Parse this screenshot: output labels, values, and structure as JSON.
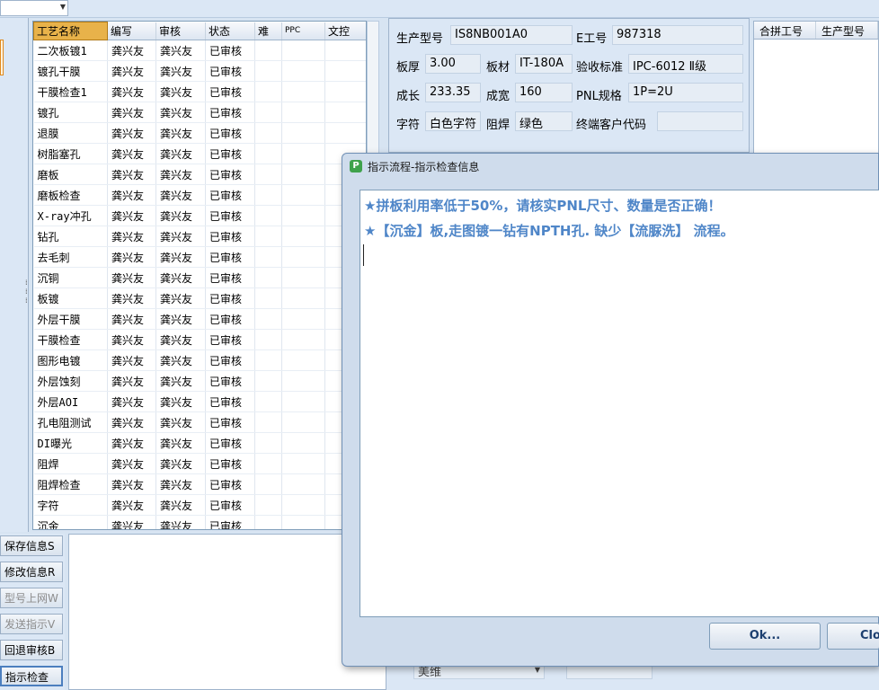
{
  "grid": {
    "headers": [
      "工艺名称",
      "编写",
      "审核",
      "状态",
      "难",
      "PPC",
      "文控"
    ],
    "rows": [
      [
        "二次板镀1",
        "龚兴友",
        "龚兴友",
        "已审核"
      ],
      [
        "镀孔干膜",
        "龚兴友",
        "龚兴友",
        "已审核"
      ],
      [
        "干膜检查1",
        "龚兴友",
        "龚兴友",
        "已审核"
      ],
      [
        "镀孔",
        "龚兴友",
        "龚兴友",
        "已审核"
      ],
      [
        "退膜",
        "龚兴友",
        "龚兴友",
        "已审核"
      ],
      [
        "树脂塞孔",
        "龚兴友",
        "龚兴友",
        "已审核"
      ],
      [
        "磨板",
        "龚兴友",
        "龚兴友",
        "已审核"
      ],
      [
        "磨板检查",
        "龚兴友",
        "龚兴友",
        "已审核"
      ],
      [
        "X-ray冲孔",
        "龚兴友",
        "龚兴友",
        "已审核"
      ],
      [
        "钻孔",
        "龚兴友",
        "龚兴友",
        "已审核"
      ],
      [
        "去毛刺",
        "龚兴友",
        "龚兴友",
        "已审核"
      ],
      [
        "沉铜",
        "龚兴友",
        "龚兴友",
        "已审核"
      ],
      [
        "板镀",
        "龚兴友",
        "龚兴友",
        "已审核"
      ],
      [
        "外层干膜",
        "龚兴友",
        "龚兴友",
        "已审核"
      ],
      [
        "干膜检查",
        "龚兴友",
        "龚兴友",
        "已审核"
      ],
      [
        "图形电镀",
        "龚兴友",
        "龚兴友",
        "已审核"
      ],
      [
        "外层蚀刻",
        "龚兴友",
        "龚兴友",
        "已审核"
      ],
      [
        "外层AOI",
        "龚兴友",
        "龚兴友",
        "已审核"
      ],
      [
        "孔电阻测试",
        "龚兴友",
        "龚兴友",
        "已审核"
      ],
      [
        "DI曝光",
        "龚兴友",
        "龚兴友",
        "已审核"
      ],
      [
        "阻焊",
        "龚兴友",
        "龚兴友",
        "已审核"
      ],
      [
        "阻焊检查",
        "龚兴友",
        "龚兴友",
        "已审核"
      ],
      [
        "字符",
        "龚兴友",
        "龚兴友",
        "已审核"
      ],
      [
        "沉金",
        "龚兴友",
        "龚兴友",
        "已审核"
      ]
    ]
  },
  "info": {
    "model_label": "生产型号",
    "model_value": "IS8NB001A0",
    "eno_label": "E工号",
    "eno_value": "987318",
    "thickness_label": "板厚",
    "thickness_value": "3.00",
    "material_label": "板材",
    "material_value": "IT-180A",
    "standard_label": "验收标准",
    "standard_value": "IPC-6012 Ⅱ级",
    "length_label": "成长",
    "length_value": "233.35",
    "width_label": "成宽",
    "width_value": "160",
    "pnl_label": "PNL规格",
    "pnl_value": "1P=2U",
    "char_label": "字符",
    "char_value": "白色字符",
    "solder_label": "阻焊",
    "solder_value": "绿色",
    "customer_label": "终端客户代码",
    "customer_value": ""
  },
  "right_panel": {
    "col1": "合拼工号",
    "col2": "生产型号"
  },
  "left_buttons": [
    {
      "label": "保存信息S",
      "state": "normal"
    },
    {
      "label": "修改信息R",
      "state": "normal"
    },
    {
      "label": "型号上网W",
      "state": "disabled"
    },
    {
      "label": "发送指示V",
      "state": "disabled"
    },
    {
      "label": "回退审核B",
      "state": "normal"
    },
    {
      "label": "指示检查",
      "state": "active"
    }
  ],
  "bottom": {
    "select_value": "美维"
  },
  "dialog": {
    "icon_glyph": "P",
    "title": "指示流程-指示检查信息",
    "messages": [
      "★拼板利用率低于50%，请核实PNL尺寸、数量是否正确！",
      "★【沉金】板,走图镀一钻有NPTH孔. 缺少【流脲洗】 流程。"
    ],
    "ok_label": "Ok...",
    "close_label": "Clo"
  },
  "colors": {
    "message_text": "#4f86c8",
    "selected_header": "#e8b24a"
  }
}
